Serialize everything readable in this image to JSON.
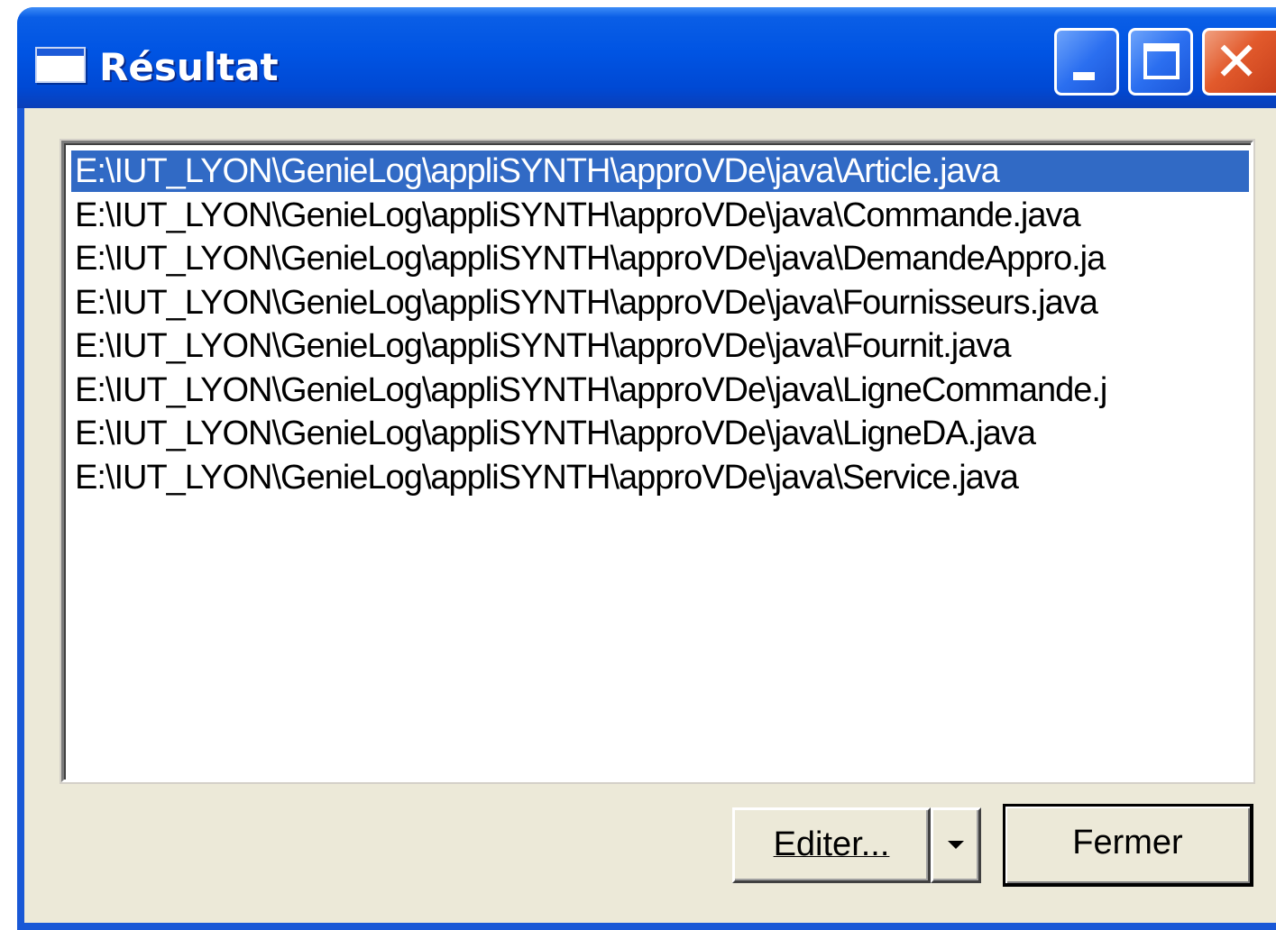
{
  "window": {
    "title": "Résultat"
  },
  "titlebar_buttons": {
    "minimize_icon": "minimize-icon",
    "maximize_icon": "maximize-icon",
    "close_icon": "close-icon",
    "close_glyph": "✕"
  },
  "file_list": {
    "selected_index": 0,
    "items": [
      "E:\\IUT_LYON\\GenieLog\\appliSYNTH\\approVDe\\java\\Article.java",
      "E:\\IUT_LYON\\GenieLog\\appliSYNTH\\approVDe\\java\\Commande.java",
      "E:\\IUT_LYON\\GenieLog\\appliSYNTH\\approVDe\\java\\DemandeAppro.ja",
      "E:\\IUT_LYON\\GenieLog\\appliSYNTH\\approVDe\\java\\Fournisseurs.java",
      "E:\\IUT_LYON\\GenieLog\\appliSYNTH\\approVDe\\java\\Fournit.java",
      "E:\\IUT_LYON\\GenieLog\\appliSYNTH\\approVDe\\java\\LigneCommande.j",
      "E:\\IUT_LYON\\GenieLog\\appliSYNTH\\approVDe\\java\\LigneDA.java",
      "E:\\IUT_LYON\\GenieLog\\appliSYNTH\\approVDe\\java\\Service.java"
    ]
  },
  "buttons": {
    "edit_label": "Editer...",
    "dropdown_icon": "chevron-down-icon",
    "close_label": "Fermer"
  },
  "colors": {
    "titlebar": "#0054e3",
    "selection": "#316ac5",
    "dialog_face": "#ece9d8",
    "close_button": "#e25a2c"
  }
}
